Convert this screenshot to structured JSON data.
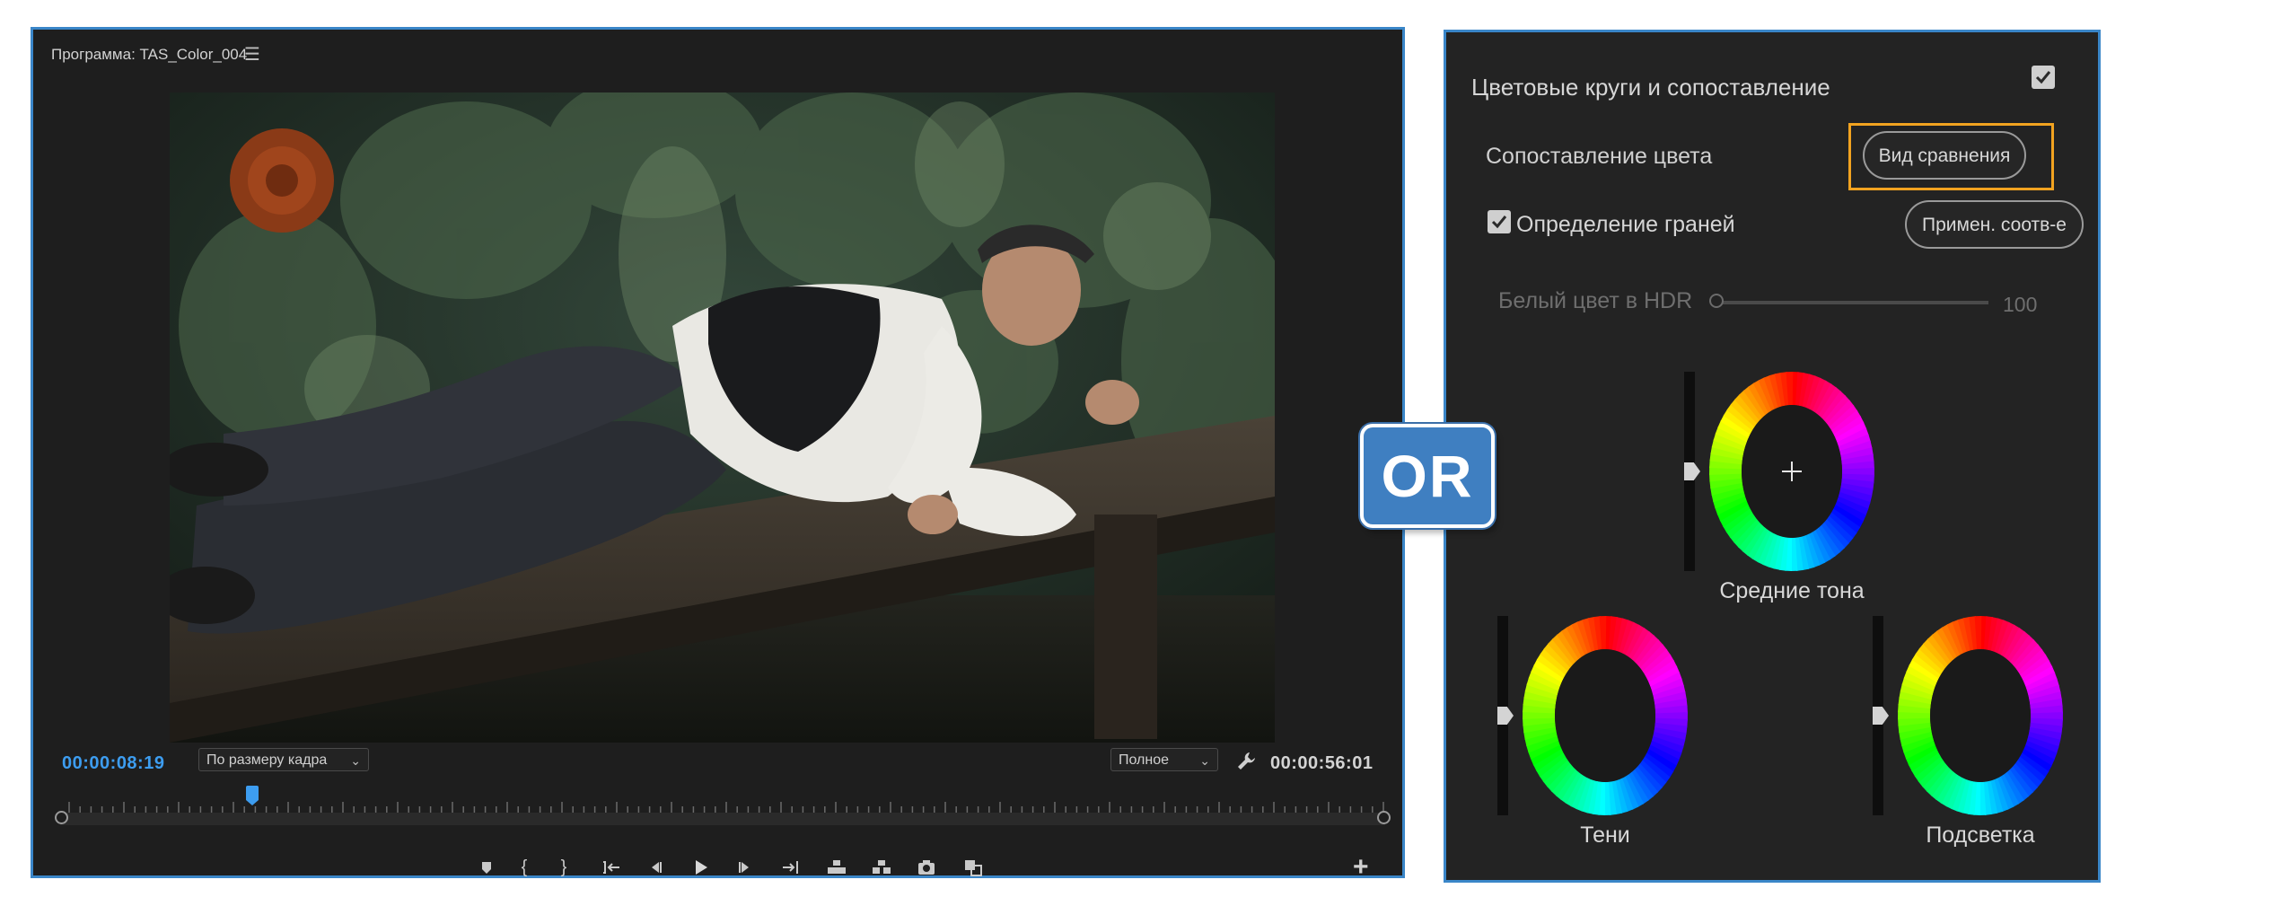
{
  "monitor": {
    "title": "Программа: TAS_Color_004",
    "menu_icon": "hamburger-menu-icon",
    "timecode_current": "00:00:08:19",
    "timecode_duration": "00:00:56:01",
    "fit_dropdown": "По размеру кадра",
    "quality_dropdown": "Полное",
    "playhead_fraction": 0.145,
    "controls": [
      {
        "name": "add-marker-button",
        "icon": "marker-icon"
      },
      {
        "name": "mark-in-button",
        "icon": "mark-in-icon",
        "glyph": "{"
      },
      {
        "name": "mark-out-button",
        "icon": "mark-out-icon",
        "glyph": "}"
      },
      {
        "name": "go-to-in-button",
        "icon": "go-to-in-icon"
      },
      {
        "name": "step-back-button",
        "icon": "step-back-icon"
      },
      {
        "name": "play-button",
        "icon": "play-icon"
      },
      {
        "name": "step-forward-button",
        "icon": "step-forward-icon"
      },
      {
        "name": "go-to-out-button",
        "icon": "go-to-out-icon"
      },
      {
        "name": "lift-button",
        "icon": "lift-icon"
      },
      {
        "name": "extract-button",
        "icon": "extract-icon"
      },
      {
        "name": "export-frame-button",
        "icon": "camera-icon"
      },
      {
        "name": "comparison-view-button",
        "icon": "comparison-view-icon"
      }
    ],
    "add_button_icon": "plus-icon"
  },
  "or_badge": "OR",
  "lumetri": {
    "section_title": "Цветовые круги и сопоставление",
    "section_enabled": true,
    "color_match_label": "Сопоставление цвета",
    "comparison_view_button": "Вид сравнения",
    "face_detection_label": "Определение граней",
    "face_detection_checked": true,
    "apply_match_button": "Примен. соотв-е",
    "hdr_white_label": "Белый цвет в HDR",
    "hdr_white_value": "100",
    "wheels": {
      "midtones": "Средние тона",
      "shadows": "Тени",
      "highlights": "Подсветка"
    },
    "colors": {
      "accent": "#3a86c8",
      "highlight": "#f2a320",
      "timecode": "#3d9df0"
    }
  }
}
